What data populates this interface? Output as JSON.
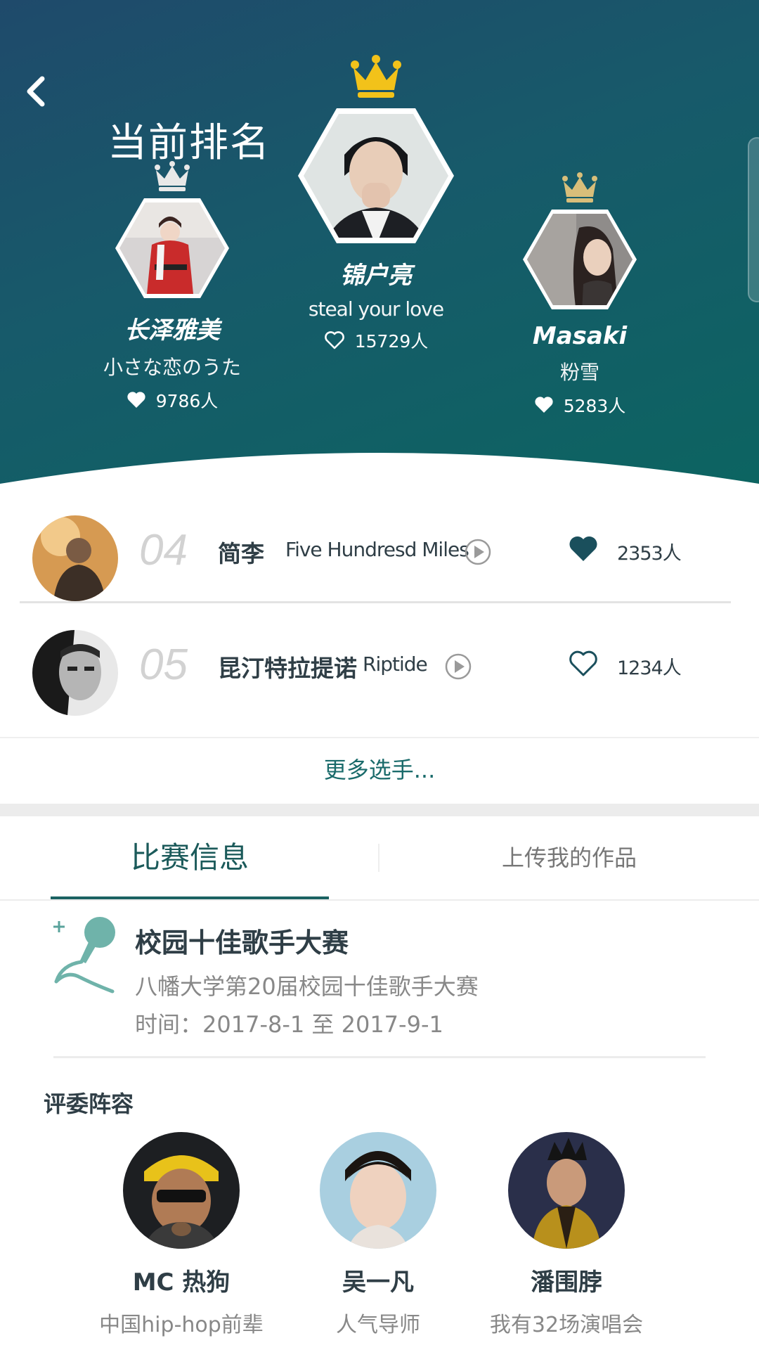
{
  "header": {
    "back_icon": "chevron-left-icon",
    "title": "当前排名"
  },
  "podium": [
    {
      "rank": 1,
      "name": "锦户亮",
      "song": "steal your love",
      "likes": "15729人",
      "crown_color": "#f2c21a",
      "liked": false
    },
    {
      "rank": 2,
      "name": "长泽雅美",
      "song": "小さな恋のうた",
      "likes": "9786人",
      "crown_color": "#e8e8e8",
      "liked": true
    },
    {
      "rank": 3,
      "name": "Masaki",
      "song": "粉雪",
      "likes": "5283人",
      "crown_color": "#d8be7a",
      "liked": true
    }
  ],
  "ranking": [
    {
      "rank": "04",
      "name": "简李",
      "song": "Five Hundresd Miles",
      "likes": "2353人",
      "liked": true
    },
    {
      "rank": "05",
      "name": "昆汀特拉提诺",
      "song": "Riptide",
      "likes": "1234人",
      "liked": false
    }
  ],
  "more_label": "更多选手...",
  "tabs": [
    {
      "label": "比赛信息",
      "active": true
    },
    {
      "label": "上传我的作品",
      "active": false
    }
  ],
  "contest": {
    "icon": "microphone-icon",
    "title": "校园十佳歌手大赛",
    "description": "八幡大学第20届校园十佳歌手大赛",
    "time": "时间：2017-8-1 至 2017-9-1"
  },
  "judges_title": "评委阵容",
  "judges": [
    {
      "name": "MC 热狗",
      "desc": "中国hip-hop前辈"
    },
    {
      "name": "吴一凡",
      "desc": "人气导师"
    },
    {
      "name": "潘围脖",
      "desc": "我有32场演唱会"
    }
  ],
  "colors": {
    "accent": "#1b6262",
    "header_top": "#1f4a6b",
    "header_bottom": "#0c6461"
  }
}
